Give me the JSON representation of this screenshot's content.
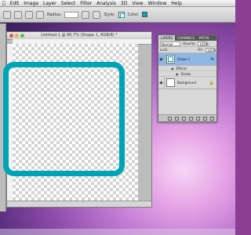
{
  "menubar": {
    "items": [
      "Edit",
      "Image",
      "Layer",
      "Select",
      "Filter",
      "Analysis",
      "3D",
      "View",
      "Window",
      "Help"
    ]
  },
  "options": {
    "radius_label": "Radius:",
    "radius_value": "",
    "style_label": "Style:",
    "color_label": "Color:",
    "color_value": "#00a8c6"
  },
  "document": {
    "title": "Untitled-1 @ 66.7% (Shape 1, RGB/8) *",
    "status": ""
  },
  "layers_panel": {
    "tabs": [
      "LAYERS",
      "CHANNELS",
      "PATHS"
    ],
    "blend_mode": "Normal",
    "opacity_label": "Opacity:",
    "opacity_value": "100%",
    "lock_label": "Lock:",
    "fill_label": "Fill:",
    "fill_value": "100%",
    "layers": [
      {
        "name": "Shape 1",
        "fx": "fx",
        "selected": true
      },
      {
        "name": "Background",
        "selected": false
      }
    ],
    "effects_label": "Effects",
    "stroke_label": "Stroke"
  },
  "colors": {
    "accent": "#00a4b4"
  }
}
